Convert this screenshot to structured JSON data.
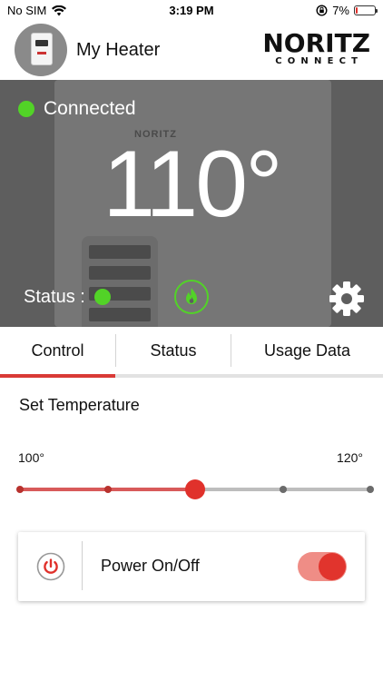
{
  "status_bar": {
    "carrier": "No SIM",
    "time": "3:19 PM",
    "battery": "7%",
    "battery_level": 0.07
  },
  "header": {
    "device_name": "My Heater",
    "brand_main": "NORITZ",
    "brand_sub": "CONNECT"
  },
  "hero": {
    "connection_label": "Connected",
    "temperature": "110°",
    "status_label": "Status :",
    "background_brand": "NORITZ"
  },
  "tabs": [
    {
      "label": "Control",
      "active": true
    },
    {
      "label": "Status",
      "active": false
    },
    {
      "label": "Usage Data",
      "active": false
    }
  ],
  "control": {
    "section_title": "Set Temperature",
    "range_min_label": "100°",
    "range_max_label": "120°",
    "slider": {
      "min": 100,
      "max": 120,
      "value": 110,
      "ticks": [
        100,
        105,
        110,
        115,
        120
      ]
    },
    "power_label": "Power On/Off",
    "power_on": true
  },
  "colors": {
    "accent": "#e0312b",
    "online": "#52d327",
    "hero_bg": "#5e5e5e"
  },
  "icons": {
    "wifi": "wifi-icon",
    "lock_rotation": "rotation-lock-icon",
    "flame": "flame-icon",
    "settings": "gear-icon",
    "power": "power-icon"
  }
}
